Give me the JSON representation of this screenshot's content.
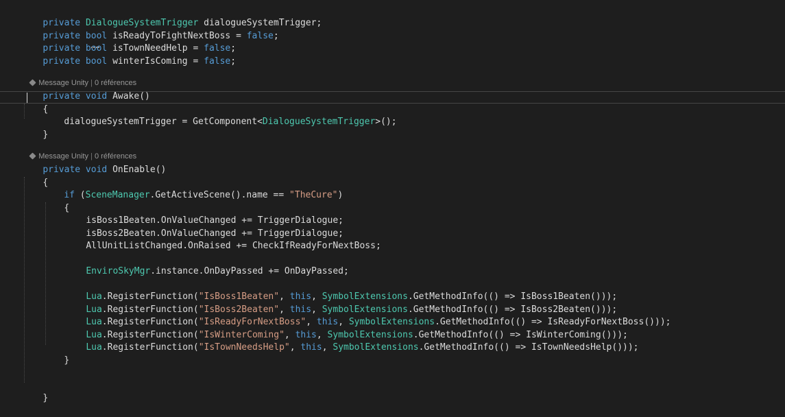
{
  "codelens": {
    "awake": {
      "message": "Message Unity",
      "refs": "0 références"
    },
    "onenable": {
      "message": "Message Unity",
      "refs": "0 références"
    }
  },
  "code": {
    "l1": {
      "kw": "private ",
      "type": "DialogueSystemTrigger",
      "rest": " dialogueSystemTrigger;"
    },
    "l2": {
      "kw": "private bool ",
      "name": "isReadyToFightNextBoss = ",
      "val": "false",
      "end": ";"
    },
    "l3": {
      "kw": "private bool ",
      "name": "isTownNeedHelp = ",
      "val": "false",
      "end": ";"
    },
    "l4": {
      "kw": "private bool ",
      "name": "winterIsComing = ",
      "val": "false",
      "end": ";"
    },
    "awake_sig": {
      "kw": "private void ",
      "name": "Awake",
      "end": "()"
    },
    "open1": "{",
    "awake_body": {
      "a": "dialogueSystemTrigger = GetComponent<",
      "type": "DialogueSystemTrigger",
      "b": ">();"
    },
    "close1": "}",
    "enable_sig": {
      "kw": "private void ",
      "name": "OnEnable",
      "end": "()"
    },
    "open2": "{",
    "if": {
      "kw": "if",
      "a": " (",
      "type": "SceneManager",
      "b": ".GetActiveScene().name == ",
      "str": "\"TheCure\"",
      "c": ")"
    },
    "open3": "{",
    "b1": "isBoss1Beaten.OnValueChanged += TriggerDialogue;",
    "b2": "isBoss2Beaten.OnValueChanged += TriggerDialogue;",
    "b3": "AllUnitListChanged.OnRaised += CheckIfReadyForNextBoss;",
    "b4": {
      "type": "EnviroSkyMgr",
      "rest": ".instance.OnDayPassed += OnDayPassed;"
    },
    "lua": [
      {
        "cls": "Lua",
        "fn": ".RegisterFunction(",
        "str": "\"IsBoss1Beaten\"",
        "comma": ", ",
        "this": "this",
        "sep": ", ",
        "ext": "SymbolExtensions",
        "rest": ".GetMethodInfo(() => IsBoss1Beaten()));"
      },
      {
        "cls": "Lua",
        "fn": ".RegisterFunction(",
        "str": "\"IsBoss2Beaten\"",
        "comma": ", ",
        "this": "this",
        "sep": ", ",
        "ext": "SymbolExtensions",
        "rest": ".GetMethodInfo(() => IsBoss2Beaten()));"
      },
      {
        "cls": "Lua",
        "fn": ".RegisterFunction(",
        "str": "\"IsReadyForNextBoss\"",
        "comma": ", ",
        "this": "this",
        "sep": ", ",
        "ext": "SymbolExtensions",
        "rest": ".GetMethodInfo(() => IsReadyForNextBoss()));"
      },
      {
        "cls": "Lua",
        "fn": ".RegisterFunction(",
        "str": "\"IsWinterComing\"",
        "comma": ", ",
        "this": "this",
        "sep": ", ",
        "ext": "SymbolExtensions",
        "rest": ".GetMethodInfo(() => IsWinterComing()));"
      },
      {
        "cls": "Lua",
        "fn": ".RegisterFunction(",
        "str": "\"IsTownNeedsHelp\"",
        "comma": ", ",
        "this": "this",
        "sep": ", ",
        "ext": "SymbolExtensions",
        "rest": ".GetMethodInfo(() => IsTownNeedsHelp()));"
      }
    ],
    "close3": "}",
    "close2": "}"
  },
  "colors": {
    "background": "#1e1e1e",
    "keyword": "#569cd6",
    "type": "#4ec9b0",
    "string": "#d69d85",
    "text": "#dcdcdc",
    "codelens": "#999999"
  }
}
